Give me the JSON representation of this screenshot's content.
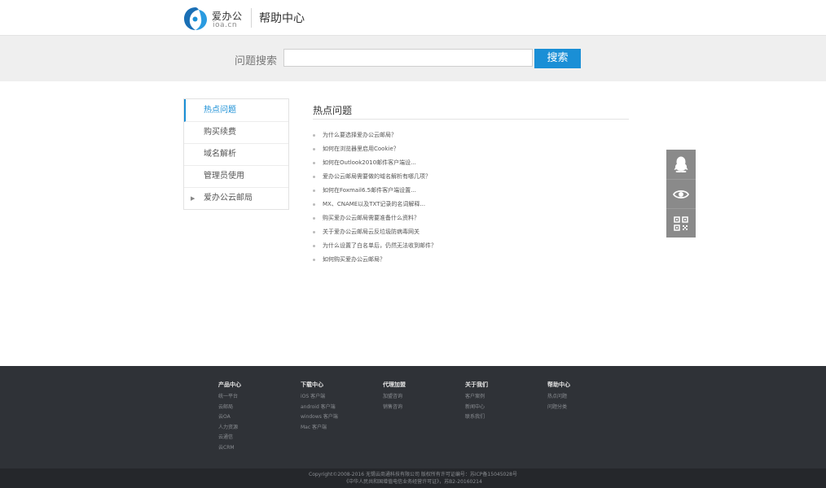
{
  "header": {
    "logo_cn": "爱办公",
    "logo_en": "ioa.cn",
    "title": "帮助中心"
  },
  "search": {
    "label": "问题搜索",
    "placeholder": "",
    "value": "",
    "button_label": "搜索"
  },
  "sidebar": {
    "items": [
      {
        "label": "热点问题"
      },
      {
        "label": "购买续费"
      },
      {
        "label": "域名解析"
      },
      {
        "label": "管理员使用"
      },
      {
        "label": "爱办公云邮局"
      }
    ]
  },
  "content": {
    "title": "热点问题",
    "questions": [
      "为什么要选择爱办公云邮局？",
      "如何在浏览器里启用Cookie？",
      "如何在Outlook2010邮件客户端设...",
      "爱办公云邮局需要做的域名解析有哪几项？",
      "如何在Foxmail6.5邮件客户端设置...",
      "MX、CNAME以及TXT记录的名词解释...",
      "购买爱办公云邮局需要准备什么资料？",
      "关于爱办公云邮局云反垃圾防病毒网关",
      "为什么设置了白名单后，仍然无法收到邮件？",
      "如何购买爱办公云邮局？"
    ]
  },
  "float_bar": {
    "icons": [
      "qq-icon",
      "eye-icon",
      "qr-code-icon"
    ]
  },
  "footer": {
    "columns": [
      {
        "title": "产品中心",
        "links": [
          "统一平台",
          "云邮局",
          "云OA",
          "人力资源",
          "云通信",
          "云CRM"
        ]
      },
      {
        "title": "下载中心",
        "links": [
          "iOS 客户端",
          "android 客户端",
          "windows 客户端",
          "Mac 客户端"
        ]
      },
      {
        "title": "代理加盟",
        "links": [
          "加盟咨询",
          "销售咨询"
        ]
      },
      {
        "title": "关于我们",
        "links": [
          "客户案例",
          "新闻中心",
          "联系我们"
        ]
      },
      {
        "title": "帮助中心",
        "links": [
          "热点问题",
          "问题分类"
        ]
      }
    ],
    "copyright_line1": "Copyright©2008-2016 无锡云商通科技有限公司 版权所有许可证编号：苏ICP备15045028号",
    "copyright_line2": "《中华人民共和国增值电信业务经营许可证》，苏B2-20160214"
  },
  "colors": {
    "accent": "#1a8fd6",
    "footer_bg": "#2f3237",
    "float_bar_bg": "#8a8a8a"
  }
}
